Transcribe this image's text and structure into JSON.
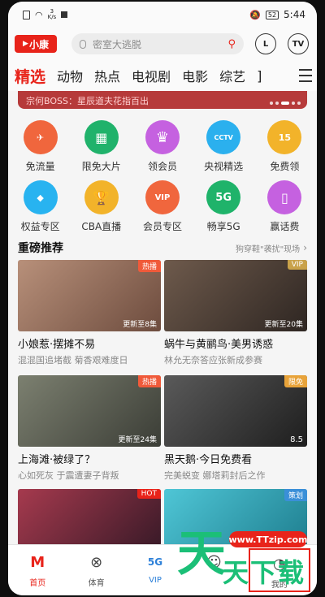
{
  "status": {
    "speed_num": "3",
    "speed_unit": "K/s",
    "battery": "52",
    "time": "5:44"
  },
  "topbar": {
    "logo": "小康",
    "search_placeholder": "密室大逃脱",
    "btn_l": "L",
    "btn_tv": "TV"
  },
  "tabs": [
    "精选",
    "动物",
    "热点",
    "电视剧",
    "电影",
    "综艺",
    "]"
  ],
  "banner": {
    "text": "宗何BOSS：星辰道夫花指百出"
  },
  "icons_row1": [
    {
      "label": "免流量",
      "icon": "flow-icon",
      "color": "#f0663d",
      "glyph": "✈"
    },
    {
      "label": "限免大片",
      "icon": "film-icon",
      "color": "#20b26b",
      "glyph": "▦"
    },
    {
      "label": "领会员",
      "icon": "crown-icon",
      "color": "#c561e0",
      "glyph": "♛"
    },
    {
      "label": "央视精选",
      "icon": "tv-icon",
      "color": "#2bb0ee",
      "glyph": "CCTV"
    },
    {
      "label": "免费领",
      "icon": "calendar-icon",
      "color": "#f2b32a",
      "glyph": "15"
    }
  ],
  "icons_row2": [
    {
      "label": "权益专区",
      "icon": "tag-icon",
      "color": "#28b3f0",
      "glyph": "◆"
    },
    {
      "label": "CBA直播",
      "icon": "trophy-icon",
      "color": "#f2b32a",
      "glyph": "🏆"
    },
    {
      "label": "会员专区",
      "icon": "vip-icon",
      "color": "#f0663d",
      "glyph": "VIP"
    },
    {
      "label": "畅享5G",
      "icon": "5g-icon",
      "color": "#1fb36a",
      "glyph": "5G"
    },
    {
      "label": "赢话费",
      "icon": "phone-icon",
      "color": "#c561e0",
      "glyph": "▯"
    }
  ],
  "section": {
    "title": "重磅推荐",
    "more": "狗穿鞋\"袭扰\"现场"
  },
  "cards": [
    {
      "title": "小娘惹·摆摊不易",
      "subtitle": "混混国追堵截 菊香艰难度日",
      "tag": "热播",
      "tag_color": "#f05a3a",
      "episodes": "更新至8集",
      "bg": "#8f6a55"
    },
    {
      "title": "蜗牛与黄鹂鸟·美男诱惑",
      "subtitle": "林允无奈答应张新成参赛",
      "tag": "VIP",
      "tag_color": "#c9a24a",
      "episodes": "更新至20集",
      "bg": "#4c4038"
    },
    {
      "title": "上海滩·被绿了？",
      "subtitle": "心如死灰 于震遭妻子背叛",
      "tag": "热播",
      "tag_color": "#f05a3a",
      "episodes": "更新至24集",
      "bg": "#585c52"
    },
    {
      "title": "黑天鹅·今日免费看",
      "subtitle": "完美蜕变 娜塔莉封后之作",
      "tag": "限免",
      "tag_color": "#e8a33a",
      "episodes": "8.5",
      "bg": "#3d3d3d"
    },
    {
      "title": "",
      "subtitle": "",
      "tag": "HOT",
      "tag_color": "#e8231a",
      "episodes": "",
      "bg": "#7b2b3e"
    },
    {
      "title": "",
      "subtitle": "",
      "tag": "策划",
      "tag_color": "#3a8fd8",
      "episodes": "",
      "bg": "#35b2c2"
    }
  ],
  "nav": [
    {
      "label": "首页",
      "icon": "home-icon"
    },
    {
      "label": "体育",
      "icon": "ball-icon"
    },
    {
      "label": "VIP",
      "icon": "5g-vip-icon"
    },
    {
      "label": "",
      "icon": "message-icon"
    },
    {
      "label": "我的",
      "icon": "profile-icon"
    }
  ],
  "watermark": {
    "url": "www.TTzip.com",
    "big": "天",
    "small": "天下载"
  }
}
